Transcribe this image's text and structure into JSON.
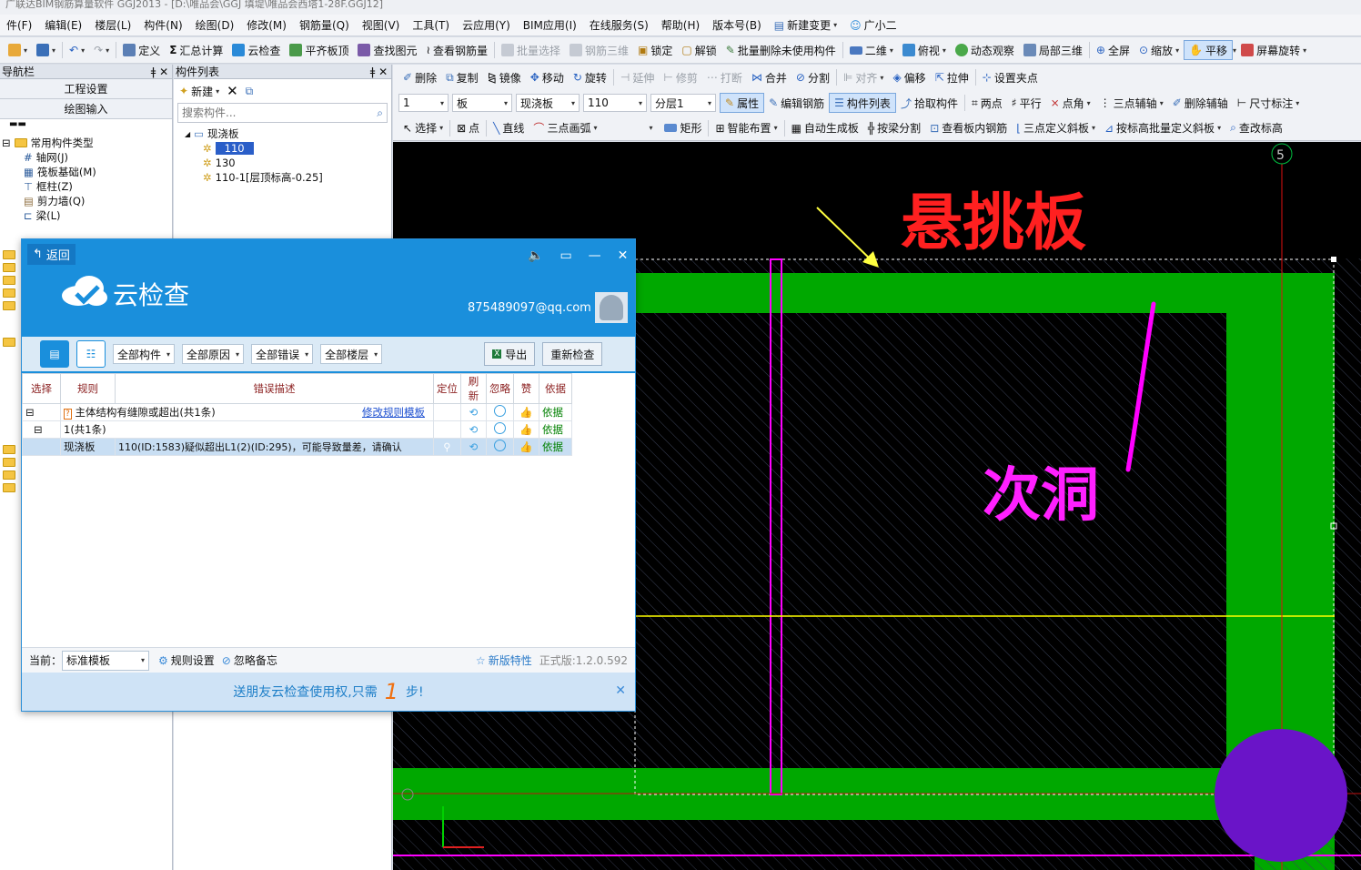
{
  "window": {
    "title": "广联达BIM钢筋算量软件 GGJ2013 - [D:\\唯品会\\GGJ 填堤\\唯品会西塔1-28F.GGJ12]"
  },
  "menu": [
    "件(F)",
    "编辑(E)",
    "楼层(L)",
    "构件(N)",
    "绘图(D)",
    "修改(M)",
    "钢筋量(Q)",
    "视图(V)",
    "工具(T)",
    "云应用(Y)",
    "BIM应用(I)",
    "在线服务(S)",
    "帮助(H)",
    "版本号(B)",
    "新建变更",
    "广小二"
  ],
  "toolbar": {
    "define": "定义",
    "sum": "汇总计算",
    "cloud_check": "云检查",
    "flat_top": "平齐板顶",
    "find": "查找图元",
    "view_rebar": "查看钢筋量",
    "batch_select": "批量选择",
    "rebar_3d": "钢筋三维",
    "lock": "锁定",
    "unlock": "解锁",
    "batch_delete": "批量删除未使用构件",
    "two_d": "二维",
    "top_view": "俯视",
    "dynamic_view": "动态观察",
    "local_3d": "局部三维",
    "fullscreen": "全屏",
    "zoom": "缩放",
    "pan": "平移",
    "screen_rotate": "屏幕旋转"
  },
  "edit_bar": {
    "delete": "删除",
    "copy": "复制",
    "mirror": "镜像",
    "move": "移动",
    "rotate": "旋转",
    "extend": "延伸",
    "trim": "修剪",
    "break": "打断",
    "merge": "合并",
    "split": "分割",
    "align": "对齐",
    "offset": "偏移",
    "stretch": "拉伸",
    "grip": "设置夹点"
  },
  "prop_bar": {
    "floor": "1",
    "type": "板",
    "subtype": "现浇板",
    "comp": "110",
    "layer": "分层1",
    "attr": "属性",
    "edit_rebar": "编辑钢筋",
    "comp_list": "构件列表",
    "pick": "拾取构件",
    "two_point": "两点",
    "parallel": "平行",
    "corner": "点角",
    "three_point_axis": "三点辅轴",
    "del_axis": "删除辅轴",
    "dim": "尺寸标注"
  },
  "draw_bar": {
    "select": "选择",
    "point": "点",
    "line": "直线",
    "arc": "三点画弧",
    "rect": "矩形",
    "smart": "智能布置",
    "auto_slab": "自动生成板",
    "split_by_beam": "按梁分割",
    "view_slab_rebar": "查看板内钢筋",
    "three_point_slope": "三点定义斜板",
    "batch_slope": "按标高批量定义斜板",
    "check_elev": "查改标高"
  },
  "nav": {
    "title": "导航栏",
    "btn1": "工程设置",
    "btn2": "绘图输入",
    "tree_root": "常用构件类型",
    "items": [
      "轴网(J)",
      "筏板基础(M)",
      "框柱(Z)",
      "剪力墙(Q)",
      "梁(L)"
    ]
  },
  "comp_list": {
    "title": "构件列表",
    "new": "新建",
    "search_placeholder": "搜索构件...",
    "root": "现浇板",
    "items": [
      "110",
      "130",
      "110-1[层顶标高-0.25]"
    ]
  },
  "dialog": {
    "back": "返回",
    "title": "云检查",
    "email": "875489097@qq.com",
    "filters": [
      "全部构件",
      "全部原因",
      "全部错误",
      "全部楼层"
    ],
    "export": "导出",
    "recheck": "重新检查",
    "headers": [
      "选择",
      "规则",
      "错误描述",
      "定位",
      "刷新",
      "忽略",
      "赞",
      "依据"
    ],
    "row1_desc": "主体结构有缝隙或超出(共1条)",
    "row1_link": "修改规则模板",
    "basis": "依据",
    "row2_desc": "1(共1条)",
    "row3_type": "现浇板",
    "row3_desc": "110(ID:1583)疑似超出L1(2)(ID:295)，可能导致量差，请确认",
    "footer_current": "当前：",
    "footer_template": "标准模板",
    "footer_rules": "规则设置",
    "footer_ignore": "忽略备忘",
    "footer_new": "新版特性",
    "footer_version": "正式版:1.2.0.592",
    "promo_pre": "送朋友云检查使用权,只需",
    "promo_num": "1",
    "promo_post": "步!"
  },
  "canvas": {
    "axis_label": "5",
    "annotation1": "悬挑板",
    "annotation2": "次洞"
  }
}
